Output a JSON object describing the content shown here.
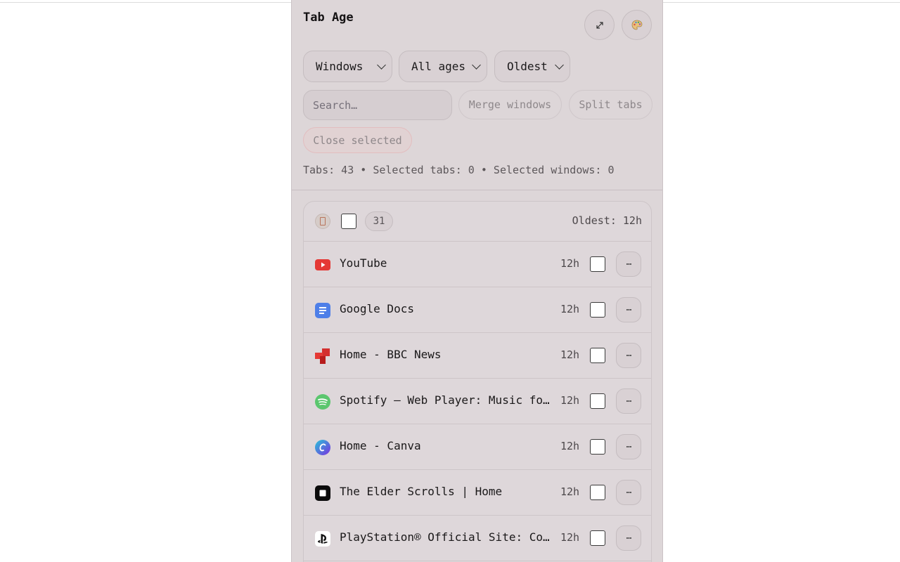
{
  "header": {
    "title": "Tab Age",
    "expand_icon": "expand-icon",
    "theme_icon": "palette-icon"
  },
  "filters": {
    "group_by": "Windows",
    "age": "All ages",
    "sort": "Oldest"
  },
  "search": {
    "placeholder": "Search…"
  },
  "actions": {
    "merge": "Merge windows",
    "split": "Split tabs",
    "close": "Close selected"
  },
  "stats": "Tabs: 43 • Selected tabs: 0 • Selected windows: 0",
  "window": {
    "count": "31",
    "oldest": "Oldest: 12h",
    "icon": "door-icon"
  },
  "tabs": [
    {
      "title": "YouTube",
      "age": "12h",
      "favicon": "youtube-icon",
      "more": "⋯"
    },
    {
      "title": "Google Docs",
      "age": "12h",
      "favicon": "google-docs-icon",
      "more": "⋯"
    },
    {
      "title": "Home - BBC News",
      "age": "12h",
      "favicon": "bbc-news-icon",
      "more": "⋯"
    },
    {
      "title": "Spotify – Web Player: Music for everyone",
      "age": "12h",
      "favicon": "spotify-icon",
      "more": "⋯"
    },
    {
      "title": "Home - Canva",
      "age": "12h",
      "favicon": "canva-icon",
      "more": "⋯"
    },
    {
      "title": "The Elder Scrolls | Home",
      "age": "12h",
      "favicon": "elder-scrolls-icon",
      "more": "⋯"
    },
    {
      "title": "PlayStation® Official Site: Consoles, Games, Accessories & More",
      "age": "12h",
      "favicon": "playstation-icon",
      "more": "⋯"
    }
  ],
  "colors": {
    "panel_bg": "#ddd6d8",
    "youtube": "#e53935",
    "docs": "#4e7fe8",
    "bbc": "#c62828",
    "spotify": "#5bc66e",
    "canva": "#7b4fe0"
  }
}
